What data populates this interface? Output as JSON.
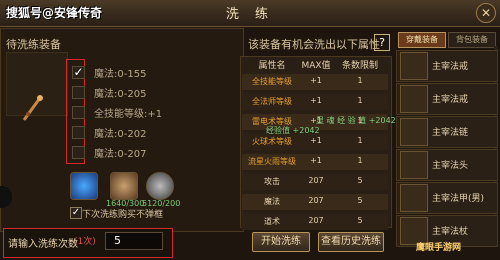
{
  "watermark": "搜狐号@安锋传奇",
  "window": {
    "title": "洗 练"
  },
  "left": {
    "heading": "待洗练装备",
    "attributes": [
      {
        "label": "魔法:0-155",
        "checked": true
      },
      {
        "label": "魔法:0-205",
        "checked": false
      },
      {
        "label": "全技能等级:+1",
        "checked": false
      },
      {
        "label": "魔法:0-202",
        "checked": false
      },
      {
        "label": "魔法:0-207",
        "checked": false
      }
    ],
    "materials": [
      {
        "count": ""
      },
      {
        "count": "1640/300"
      },
      {
        "count": "5120/200"
      }
    ],
    "auto_buy_label": "下次洗练购买不弹框",
    "input_label": "请输入洗练次数",
    "input_hint": "(1次)",
    "input_value": "5"
  },
  "right": {
    "header": "该装备有机会洗出以下属性",
    "help": "?",
    "table": {
      "headers": [
        "属性名",
        "MAX值",
        "条数限制"
      ],
      "rows": [
        {
          "name": "全技能等级",
          "max": "+1",
          "limit": "1",
          "color": "#e8a030"
        },
        {
          "name": "全法师等级",
          "max": "+1",
          "limit": "1",
          "color": "#e8a030"
        },
        {
          "name": "雷电术等级",
          "max": "+1",
          "limit": "1",
          "color": "#e8a030"
        },
        {
          "name": "火球术等级",
          "max": "+1",
          "limit": "1",
          "color": "#e8a030"
        },
        {
          "name": "流星火雨等级",
          "max": "+1",
          "limit": "1",
          "color": "#e8a030"
        },
        {
          "name": "攻击",
          "max": "207",
          "limit": "5",
          "color": "#e6d4b0"
        },
        {
          "name": "魔法",
          "max": "207",
          "limit": "5",
          "color": "#e6d4b0"
        },
        {
          "name": "道术",
          "max": "207",
          "limit": "5",
          "color": "#e6d4b0"
        }
      ]
    },
    "floaters": [
      "显 魂 经 验 值 +2042",
      "经验值 +2042"
    ],
    "buttons": {
      "start": "开始洗练",
      "history": "查看历史洗练"
    }
  },
  "sidebar": {
    "tabs": [
      "穿戴装备",
      "背包装备"
    ],
    "items": [
      {
        "name": "主宰法戒"
      },
      {
        "name": "主宰法戒"
      },
      {
        "name": "主宰法链"
      },
      {
        "name": "主宰法头"
      },
      {
        "name": "主宰法甲(男)"
      },
      {
        "name": "主宰法杖"
      }
    ]
  },
  "footer_watermark": "鹰眼手游网"
}
